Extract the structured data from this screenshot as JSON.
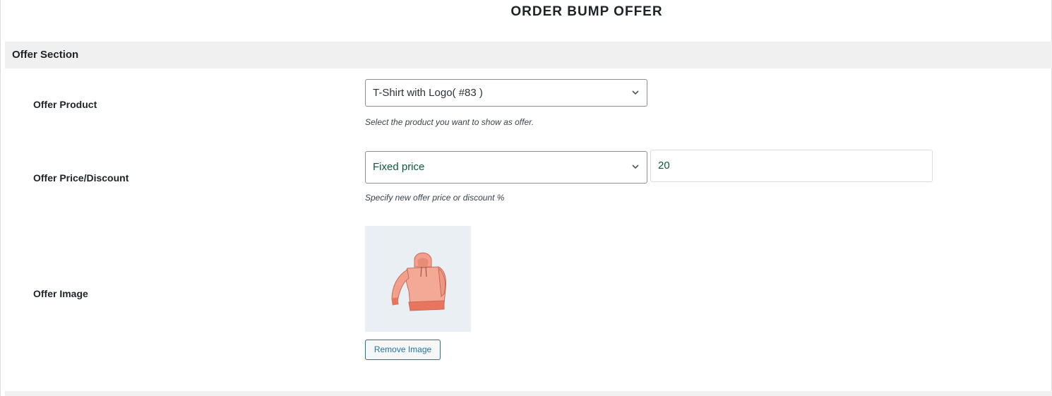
{
  "page": {
    "title": "ORDER BUMP OFFER"
  },
  "section": {
    "title": "Offer Section"
  },
  "offer_product": {
    "label": "Offer Product",
    "selected": "T-Shirt with Logo( #83 )",
    "help": "Select the product you want to show as offer."
  },
  "offer_price": {
    "label": "Offer Price/Discount",
    "type_selected": "Fixed price",
    "value": "20",
    "help": "Specify new offer price or discount %"
  },
  "offer_image": {
    "label": "Offer Image",
    "icon": "hoodie-image",
    "remove_label": "Remove Image"
  },
  "colors": {
    "accent": "#2271b1",
    "value_text": "#0a5c36",
    "section_bg": "#f0f0f1"
  }
}
